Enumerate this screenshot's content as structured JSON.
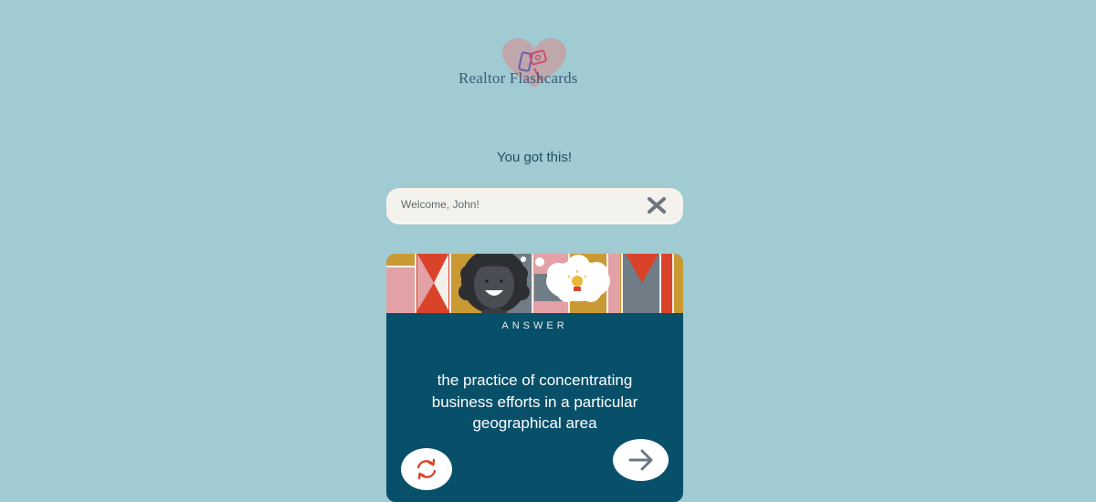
{
  "logo": {
    "text": "Realtor Flashcards",
    "icon": "heart-cards-logo-icon"
  },
  "tagline": "You got this!",
  "welcome": {
    "text": "Welcome, John!",
    "close_icon": "close-icon"
  },
  "card": {
    "label": "ANSWER",
    "answer": "the practice of concentrating business efforts in a particular geographical area",
    "banner_icon": "woman-thinking-lightbulb-illustration",
    "flip_icon": "flip-refresh-icon",
    "next_icon": "arrow-right-icon"
  },
  "colors": {
    "background": "#a0cbd2",
    "card": "#08506a",
    "accent_red": "#d9432a",
    "accent_gold": "#c99a34",
    "accent_pink": "#e2a1a5",
    "accent_gray": "#707c86"
  }
}
